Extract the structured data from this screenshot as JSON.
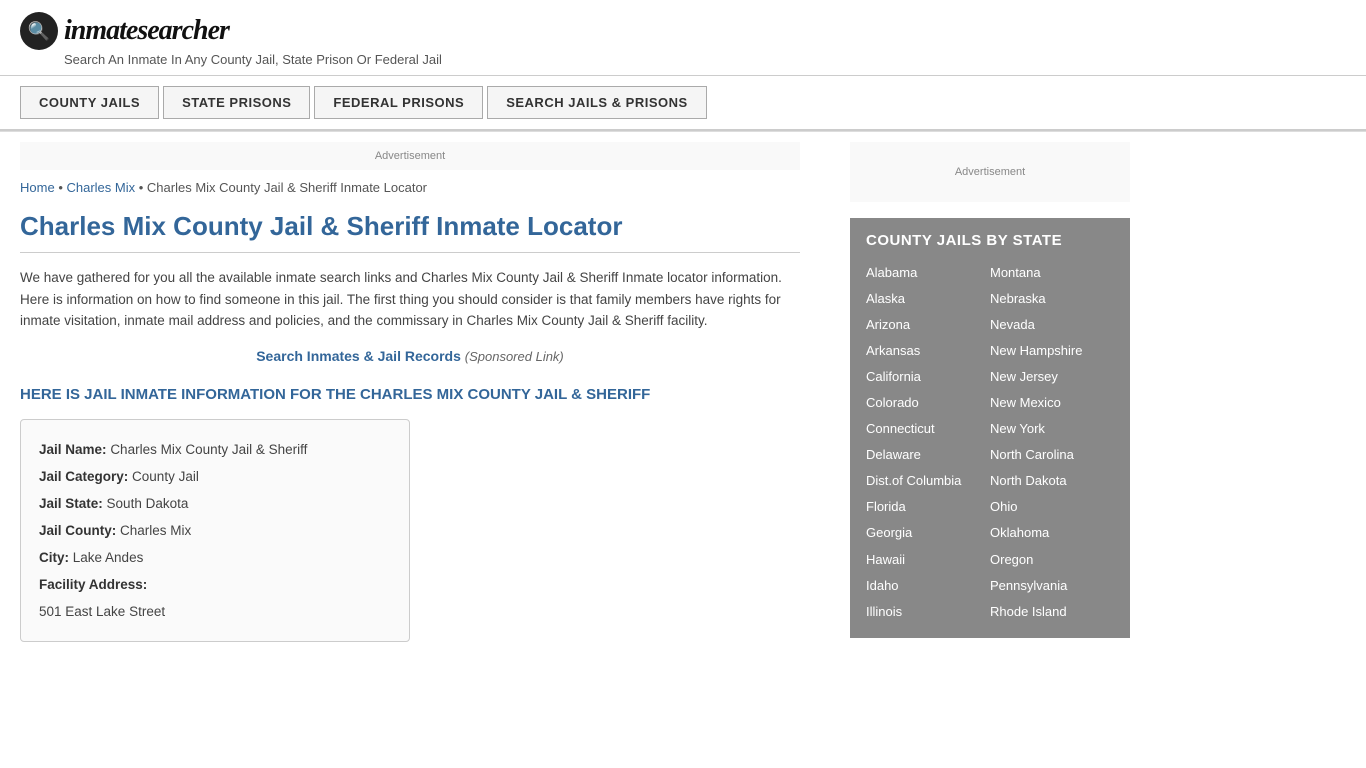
{
  "header": {
    "logo_icon": "🔍",
    "logo_text_plain": "inmate",
    "logo_text_italic": "searcher",
    "tagline": "Search An Inmate In Any County Jail, State Prison Or Federal Jail"
  },
  "nav": {
    "items": [
      {
        "id": "county-jails",
        "label": "COUNTY JAILS"
      },
      {
        "id": "state-prisons",
        "label": "STATE PRISONS"
      },
      {
        "id": "federal-prisons",
        "label": "FEDERAL PRISONS"
      },
      {
        "id": "search-jails",
        "label": "SEARCH JAILS & PRISONS"
      }
    ]
  },
  "ads": {
    "top_label": "Advertisement",
    "sidebar_label": "Advertisement"
  },
  "breadcrumb": {
    "home": "Home",
    "parent": "Charles Mix",
    "current": "Charles Mix County Jail & Sheriff Inmate Locator"
  },
  "page": {
    "title": "Charles Mix County Jail & Sheriff Inmate Locator",
    "description": "We have gathered for you all the available inmate search links and Charles Mix County Jail & Sheriff Inmate locator information. Here is information on how to find someone in this jail. The first thing you should consider is that family members have rights for inmate visitation, inmate mail address and policies, and the commissary in Charles Mix County Jail & Sheriff facility.",
    "search_link_text": "Search Inmates & Jail Records",
    "sponsored_text": "(Sponsored Link)",
    "jail_section_header": "HERE IS JAIL INMATE INFORMATION FOR THE CHARLES MIX COUNTY JAIL & SHERIFF"
  },
  "jail_info": {
    "name_label": "Jail Name:",
    "name_value": "Charles Mix County Jail & Sheriff",
    "category_label": "Jail Category:",
    "category_value": "County Jail",
    "state_label": "Jail State:",
    "state_value": "South Dakota",
    "county_label": "Jail County:",
    "county_value": "Charles Mix",
    "city_label": "City:",
    "city_value": "Lake Andes",
    "address_label": "Facility Address:",
    "address_value": "501 East Lake Street"
  },
  "sidebar": {
    "state_section_title": "COUNTY JAILS BY STATE",
    "states_left": [
      "Alabama",
      "Alaska",
      "Arizona",
      "Arkansas",
      "California",
      "Colorado",
      "Connecticut",
      "Delaware",
      "Dist.of Columbia",
      "Florida",
      "Georgia",
      "Hawaii",
      "Idaho",
      "Illinois"
    ],
    "states_right": [
      "Montana",
      "Nebraska",
      "Nevada",
      "New Hampshire",
      "New Jersey",
      "New Mexico",
      "New York",
      "North Carolina",
      "North Dakota",
      "Ohio",
      "Oklahoma",
      "Oregon",
      "Pennsylvania",
      "Rhode Island"
    ]
  }
}
